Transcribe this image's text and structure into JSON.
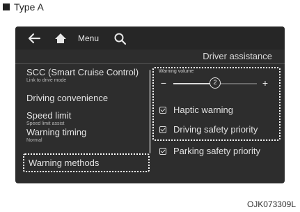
{
  "caption": {
    "label": "Type A"
  },
  "topbar": {
    "menu_label": "Menu"
  },
  "section_title": "Driver assistance",
  "left_menu": {
    "items": [
      {
        "label": "SCC (Smart Cruise Control)",
        "sublabel": "Link to drive mode"
      },
      {
        "label": "Driving convenience",
        "sublabel": ""
      },
      {
        "label": "Speed limit",
        "sublabel": "Speed limit assist"
      },
      {
        "label": "Warning timing",
        "sublabel": "Normal"
      },
      {
        "label": "Warning methods",
        "sublabel": ""
      }
    ]
  },
  "warning_volume": {
    "label": "Warning volume",
    "value": "2",
    "minus_symbol": "−",
    "plus_symbol": "+",
    "level_fraction": 0.5
  },
  "options": [
    {
      "label": "Haptic warning",
      "checked": true
    },
    {
      "label": "Driving safety priority",
      "checked": true
    },
    {
      "label": "Parking safety priority",
      "checked": true
    }
  ],
  "image_code": "OJK073309L"
}
